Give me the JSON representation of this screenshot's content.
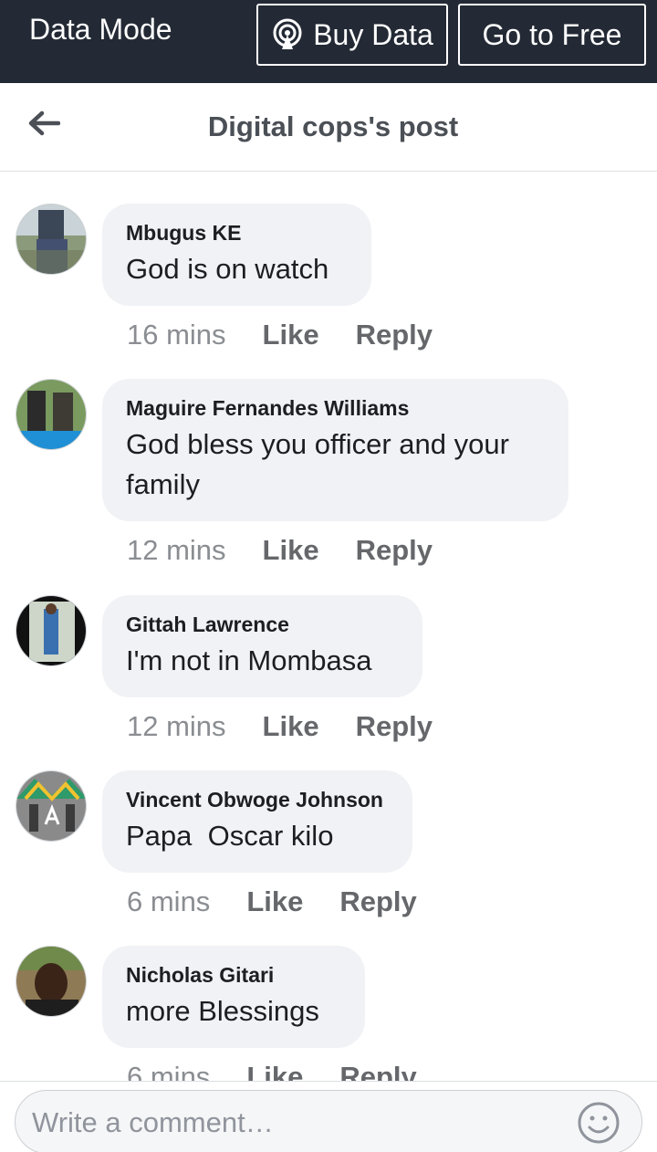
{
  "topbar": {
    "mode_label": "Data Mode",
    "buy_label": "Buy Data",
    "free_label": "Go to Free"
  },
  "header": {
    "title": "Digital cops's post"
  },
  "comments": [
    {
      "name": "Mbugus KE",
      "text": "God is on watch",
      "time": "16 mins",
      "like": "Like",
      "reply": "Reply"
    },
    {
      "name": "Maguire Fernandes Williams",
      "text": "God bless you officer and your family",
      "time": "12 mins",
      "like": "Like",
      "reply": "Reply"
    },
    {
      "name": "Gittah Lawrence",
      "text": "I'm not in Mombasa",
      "time": "12 mins",
      "like": "Like",
      "reply": "Reply"
    },
    {
      "name": "Vincent Obwoge Johnson",
      "text": "Papa  Oscar kilo",
      "time": "6 mins",
      "like": "Like",
      "reply": "Reply"
    },
    {
      "name": "Nicholas Gitari",
      "text": "more Blessings",
      "time": "6 mins",
      "like": "Like",
      "reply": "Reply"
    }
  ],
  "composer": {
    "placeholder": "Write a comment…"
  },
  "icons": {
    "buy": "broadcast-icon",
    "back": "back-arrow-icon",
    "emoji": "smiley-icon"
  },
  "colors": {
    "topbar_bg": "#232a35",
    "bubble_bg": "#f0f2f5",
    "title_text": "#4b4f56"
  }
}
